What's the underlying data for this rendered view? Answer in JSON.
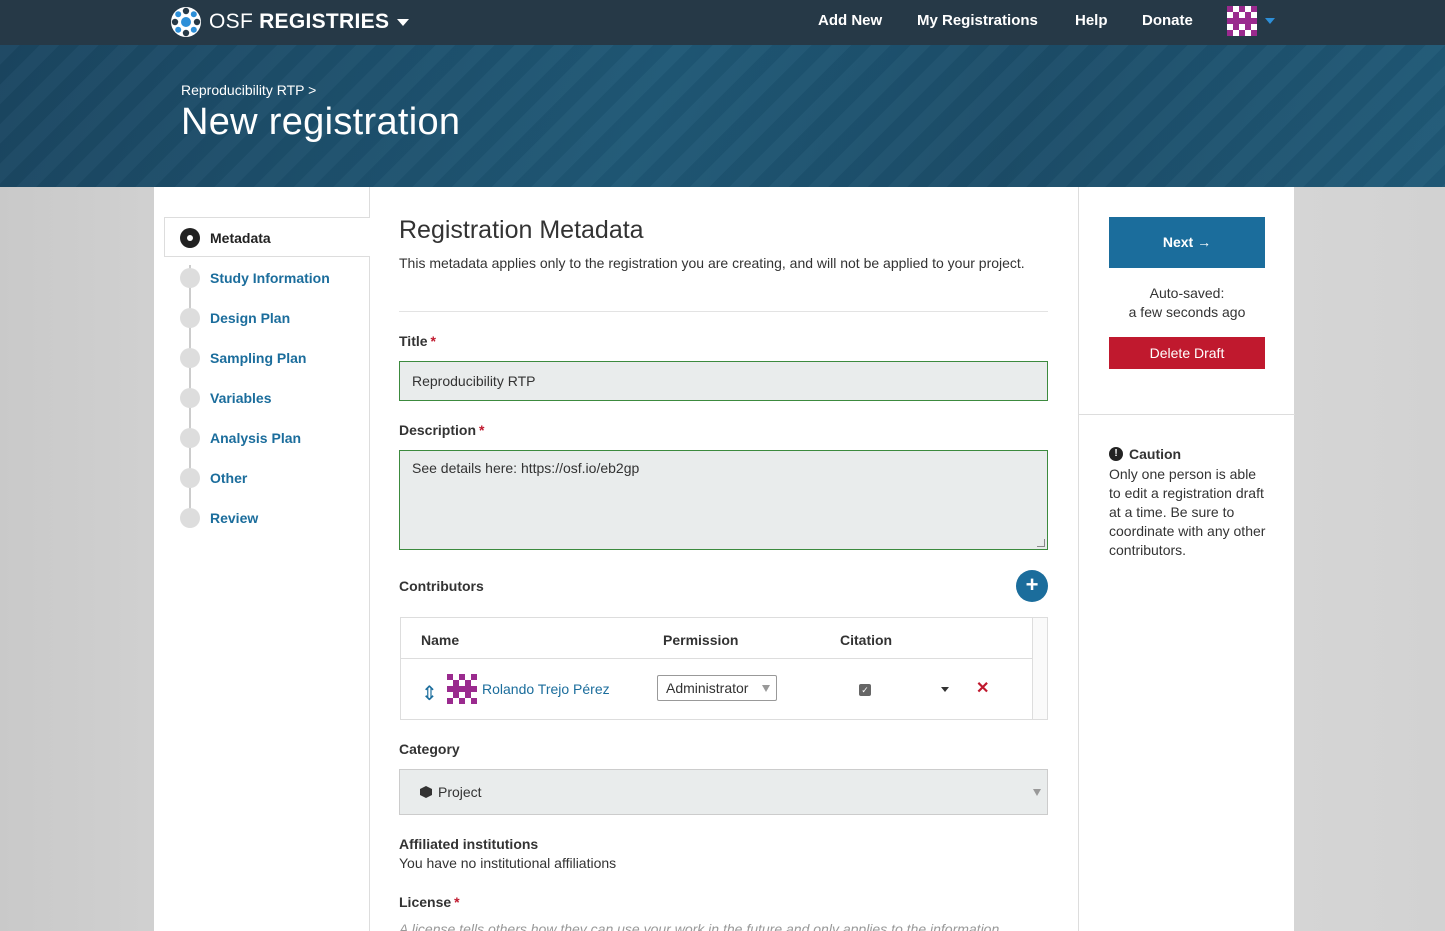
{
  "navbar": {
    "brand_osf": "OSF",
    "brand_registries": "REGISTRIES",
    "items": [
      "Add New",
      "My Registrations",
      "Help",
      "Donate"
    ]
  },
  "hero": {
    "breadcrumb": "Reproducibility RTP >",
    "title": "New registration"
  },
  "steps": [
    {
      "label": "Metadata",
      "active": true
    },
    {
      "label": "Study Information",
      "active": false
    },
    {
      "label": "Design Plan",
      "active": false
    },
    {
      "label": "Sampling Plan",
      "active": false
    },
    {
      "label": "Variables",
      "active": false
    },
    {
      "label": "Analysis Plan",
      "active": false
    },
    {
      "label": "Other",
      "active": false
    },
    {
      "label": "Review",
      "active": false
    }
  ],
  "main": {
    "title": "Registration Metadata",
    "description": "This metadata applies only to the registration you are creating, and will not be applied to your project.",
    "title_label": "Title",
    "title_value": "Reproducibility RTP",
    "description_label": "Description",
    "description_value": "See details here: https://osf.io/eb2gp",
    "required_mark": "*",
    "contributors_label": "Contributors",
    "contributors_columns": [
      "Name",
      "Permission",
      "Citation"
    ],
    "contributor": {
      "name": "Rolando Trejo Pérez",
      "permission": "Administrator",
      "citation": true
    },
    "category_label": "Category",
    "category_value": "Project",
    "affiliated_label": "Affiliated institutions",
    "affiliated_text": "You have no institutional affiliations",
    "license_label": "License",
    "license_desc": "A license tells others how they can use your work in the future and only applies to the information"
  },
  "sidebar_right": {
    "next_label": "Next",
    "autosave_label": "Auto-saved:",
    "autosave_time": "a few seconds ago",
    "delete_label": "Delete Draft",
    "caution_title": "Caution",
    "caution_text": "Only one person is able to edit a registration draft at a time. Be sure to coordinate with any other contributors."
  },
  "colors": {
    "navbar": "#263947",
    "accent": "#1b6d9c",
    "danger": "#c0192e",
    "valid_border": "#3c8a3e"
  }
}
